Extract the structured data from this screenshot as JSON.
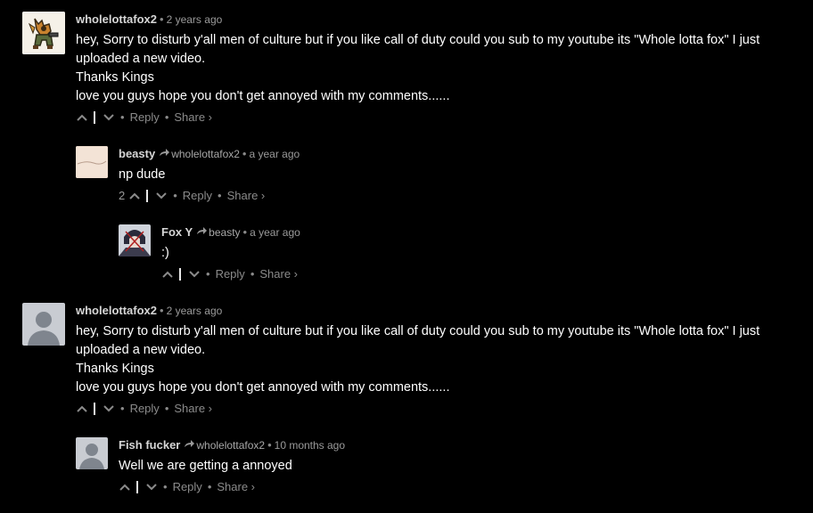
{
  "comments": [
    {
      "author": "wholelottafox2",
      "time": "2 years ago",
      "reply_to": "",
      "votes": "",
      "lines": [
        "hey, Sorry to disturb y'all men of culture but if you like call of duty could you sub to my youtube its \"Whole lotta fox\" I just uploaded a new video.",
        "Thanks Kings",
        "love you guys hope you don't get annoyed with my comments......"
      ],
      "avatar": "fox-character-avatar"
    },
    {
      "author": "beasty",
      "time": "a year ago",
      "reply_to": "wholelottafox2",
      "votes": "2",
      "lines": [
        "np dude"
      ],
      "avatar": "beige-sketch-avatar"
    },
    {
      "author": "Fox Y",
      "time": "a year ago",
      "reply_to": "beasty",
      "votes": "",
      "lines": [
        ":)"
      ],
      "avatar": "anime-character-avatar"
    },
    {
      "author": "wholelottafox2",
      "time": "2 years ago",
      "reply_to": "",
      "votes": "",
      "lines": [
        "hey, Sorry to disturb y'all men of culture but if you like call of duty could you sub to my youtube its \"Whole lotta fox\" I just uploaded a new video.",
        "Thanks Kings",
        "love you guys hope you don't get annoyed with my comments......"
      ],
      "avatar": "default-user-avatar"
    },
    {
      "author": "Fish fucker",
      "time": "10 months ago",
      "reply_to": "wholelottafox2",
      "votes": "",
      "lines": [
        "Well we are getting a annoyed"
      ],
      "avatar": "default-user-avatar"
    }
  ],
  "actions": {
    "reply_label": "Reply",
    "share_label": "Share ›",
    "bullet": "•"
  },
  "colors": {
    "background": "#000000",
    "text": "#ffffff",
    "author": "#d6d6d6",
    "meta": "#9a9a9a"
  }
}
